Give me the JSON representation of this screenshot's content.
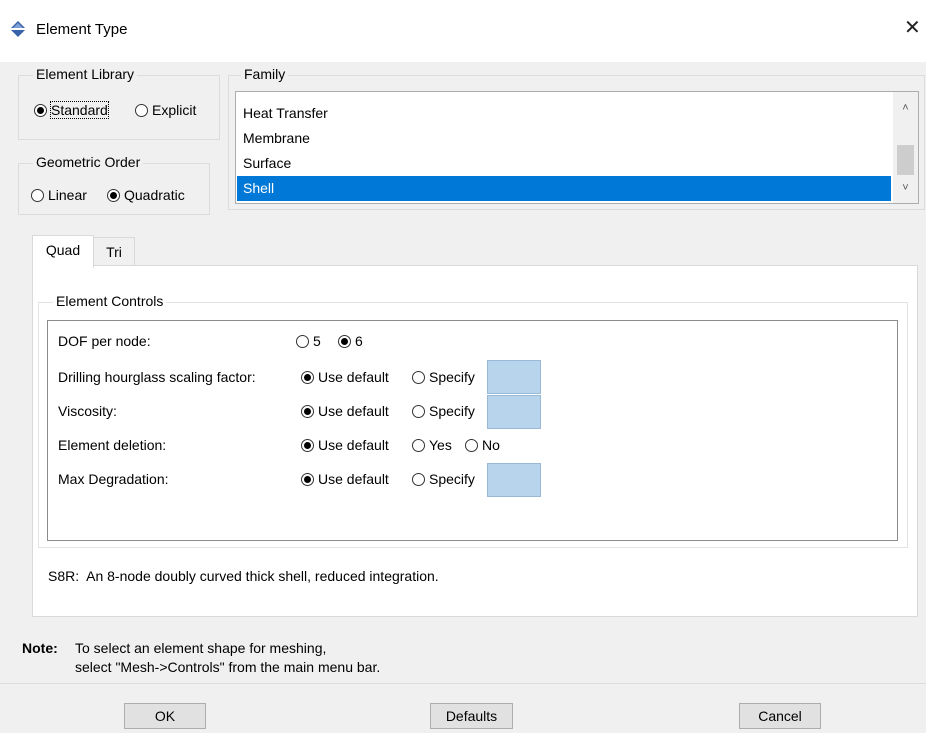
{
  "window": {
    "title": "Element Type",
    "icon": "abaqus-diamond-icon",
    "close_glyph": "✕"
  },
  "element_library": {
    "legend": "Element Library",
    "options": [
      {
        "label": "Standard",
        "selected": true
      },
      {
        "label": "Explicit",
        "selected": false
      }
    ]
  },
  "geometric_order": {
    "legend": "Geometric Order",
    "options": [
      {
        "label": "Linear",
        "selected": false
      },
      {
        "label": "Quadratic",
        "selected": true
      }
    ]
  },
  "family": {
    "legend": "Family",
    "items": [
      "Heat Transfer",
      "Membrane",
      "Surface",
      "Shell"
    ],
    "selected": "Shell"
  },
  "tabs": [
    {
      "label": "Quad",
      "active": true
    },
    {
      "label": "Tri",
      "active": false
    }
  ],
  "element_controls": {
    "legend": "Element Controls",
    "rows": [
      {
        "label": "DOF per node:",
        "options": [
          {
            "label": "5",
            "selected": false
          },
          {
            "label": "6",
            "selected": true
          }
        ],
        "has_field": false
      },
      {
        "label": "Drilling hourglass scaling factor:",
        "options": [
          {
            "label": "Use default",
            "selected": true
          },
          {
            "label": "Specify",
            "selected": false
          }
        ],
        "has_field": true
      },
      {
        "label": "Viscosity:",
        "options": [
          {
            "label": "Use default",
            "selected": true
          },
          {
            "label": "Specify",
            "selected": false
          }
        ],
        "has_field": true
      },
      {
        "label": "Element deletion:",
        "options": [
          {
            "label": "Use default",
            "selected": true
          },
          {
            "label": "Yes",
            "selected": false
          },
          {
            "label": "No",
            "selected": false
          }
        ],
        "has_field": false
      },
      {
        "label": "Max Degradation:",
        "options": [
          {
            "label": "Use default",
            "selected": true
          },
          {
            "label": "Specify",
            "selected": false
          }
        ],
        "has_field": true
      }
    ]
  },
  "description": "S8R:  An 8-node doubly curved thick shell, reduced integration.",
  "note": {
    "label": "Note:",
    "line1": "To select an element shape for meshing,",
    "line2": "select \"Mesh->Controls\" from the main menu bar."
  },
  "buttons": {
    "ok": "OK",
    "defaults": "Defaults",
    "cancel": "Cancel"
  },
  "colors": {
    "selection": "#0078d7",
    "field": "#b8d4ec",
    "background": "#f0f0f0"
  }
}
